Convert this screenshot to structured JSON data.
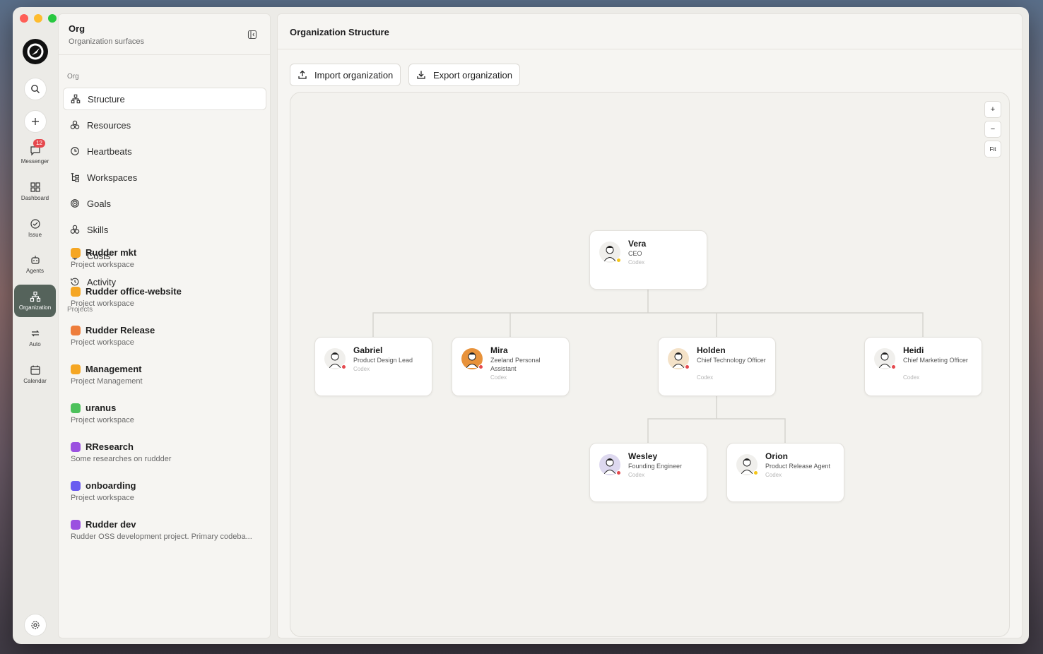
{
  "rail": {
    "badge_count": "12",
    "items": [
      {
        "label": "Messenger"
      },
      {
        "label": "Dashboard"
      },
      {
        "label": "Issue"
      },
      {
        "label": "Agents"
      },
      {
        "label": "Organization"
      },
      {
        "label": "Auto"
      },
      {
        "label": "Calendar"
      }
    ]
  },
  "sidebar": {
    "title": "Org",
    "subtitle": "Organization surfaces",
    "section_org": "Org",
    "nav": [
      {
        "label": "Structure"
      },
      {
        "label": "Resources"
      },
      {
        "label": "Heartbeats"
      },
      {
        "label": "Workspaces"
      },
      {
        "label": "Goals"
      },
      {
        "label": "Skills"
      },
      {
        "label": "Costs"
      },
      {
        "label": "Activity"
      }
    ],
    "section_projects": "Projects",
    "projects": [
      {
        "name": "Rudder mkt",
        "desc": "Project workspace",
        "color": "#f5a623"
      },
      {
        "name": "Rudder office-website",
        "desc": "Project workspace",
        "color": "#f5a623"
      },
      {
        "name": "Rudder Release",
        "desc": "Project workspace",
        "color": "#ee7d3b"
      },
      {
        "name": "Management",
        "desc": "Project Management",
        "color": "#f5a623"
      },
      {
        "name": "uranus",
        "desc": "Project workspace",
        "color": "#4cc15b"
      },
      {
        "name": "RResearch",
        "desc": "Some researches on ruddder",
        "color": "#9b51e0"
      },
      {
        "name": "onboarding",
        "desc": "Project workspace",
        "color": "#6a5cf0"
      },
      {
        "name": "Rudder dev",
        "desc": "Rudder OSS development project. Primary codeba...",
        "color": "#9b51e0"
      }
    ]
  },
  "main": {
    "title": "Organization Structure",
    "import_label": "Import organization",
    "export_label": "Export organization",
    "zoom_in": "+",
    "zoom_out": "−",
    "fit": "Fit"
  },
  "org": [
    {
      "name": "Vera",
      "role": "CEO",
      "tool": "Codex",
      "status": "#f5c518"
    },
    {
      "name": "Gabriel",
      "role": "Product Design Lead",
      "tool": "Codex",
      "status": "#e5484d"
    },
    {
      "name": "Mira",
      "role": "Zeeland Personal Assistant",
      "tool": "Codex",
      "status": "#e5484d"
    },
    {
      "name": "Holden",
      "role": "Chief Technology Officer",
      "tool": "Codex",
      "status": "#e5484d"
    },
    {
      "name": "Heidi",
      "role": "Chief Marketing Officer",
      "tool": "Codex",
      "status": "#e5484d"
    },
    {
      "name": "Wesley",
      "role": "Founding Engineer",
      "tool": "Codex",
      "status": "#e5484d"
    },
    {
      "name": "Orion",
      "role": "Product Release Agent",
      "tool": "Codex",
      "status": "#f5c518"
    }
  ]
}
